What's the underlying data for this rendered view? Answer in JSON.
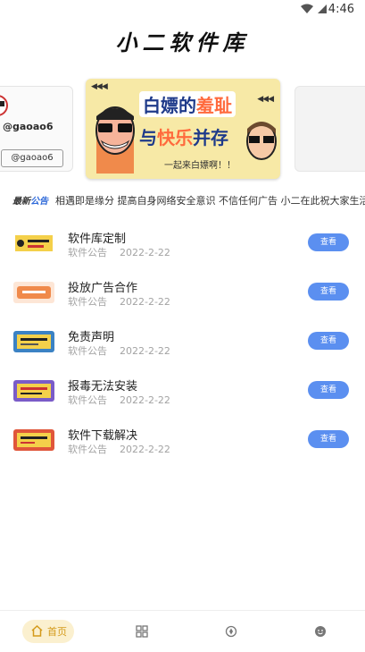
{
  "status_bar": {
    "time": "4:46"
  },
  "app": {
    "title": "小二软件库"
  },
  "carousel": {
    "left_card": {
      "handle_top": "@gaoao6",
      "handle_bottom": "@gaoao6"
    },
    "banner": {
      "line1_pre": "白嫖的",
      "line1_hl": "羞耻",
      "line2_pre": "与",
      "line2_hl": "快乐",
      "line2_post": "并存",
      "tagline": "一起来白嫖啊！！",
      "dots": "◀◀◀"
    }
  },
  "ticker": {
    "label_pre": "最新",
    "label_hl": "公告",
    "text": "相遇即是缘分  提高自身网络安全意识  不信任何广告  小二在此祝大家生活"
  },
  "announcements": [
    {
      "title": "软件库定制",
      "category": "软件公告",
      "date": "2022-2-22",
      "action": "查看",
      "thumb_color": "#f4d04a"
    },
    {
      "title": "投放广告合作",
      "category": "软件公告",
      "date": "2022-2-22",
      "action": "查看",
      "thumb_color": "#f08a4b"
    },
    {
      "title": "免责声明",
      "category": "软件公告",
      "date": "2022-2-22",
      "action": "查看",
      "thumb_color": "#3b82c4"
    },
    {
      "title": "报毒无法安装",
      "category": "软件公告",
      "date": "2022-2-22",
      "action": "查看",
      "thumb_color": "#7a5cc8"
    },
    {
      "title": "软件下载解决",
      "category": "软件公告",
      "date": "2022-2-22",
      "action": "查看",
      "thumb_color": "#e0563a"
    }
  ],
  "tabbar": {
    "home_label": "首页",
    "icons": [
      "home-icon",
      "grid-icon",
      "compass-icon",
      "smile-icon"
    ]
  },
  "colors": {
    "accent": "#5b8ff0",
    "home_tab_bg": "#fbf0cf",
    "home_tab_text": "#d49a1a",
    "banner_bg": "#f7e9a6"
  }
}
